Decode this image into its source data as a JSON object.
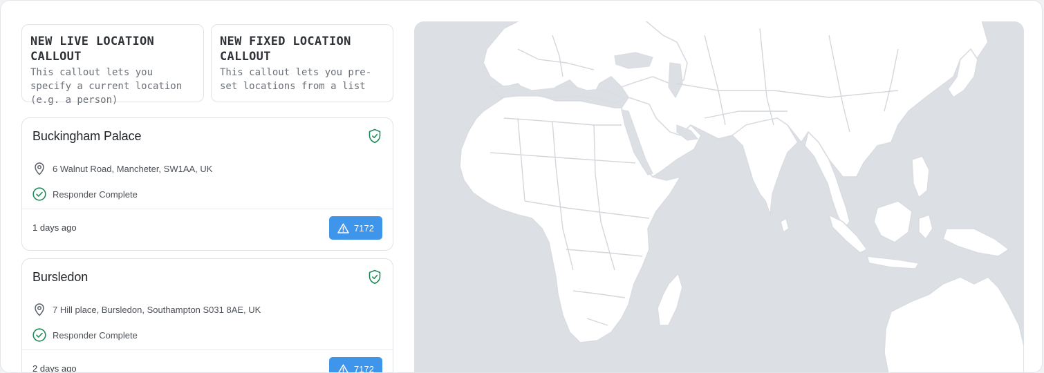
{
  "callout_options": [
    {
      "title": "NEW LIVE LOCATION CALLOUT",
      "description": "This callout lets you specify a current location (e.g. a person)"
    },
    {
      "title": "NEW FIXED LOCATION CALLOUT",
      "description": "This callout lets you pre-set locations from a list"
    }
  ],
  "locations": [
    {
      "name": "Buckingham Palace",
      "address": "6 Walnut Road, Mancheter, SW1AA, UK",
      "status": "Responder Complete",
      "time_ago": "1 days ago",
      "alert_count": "7172",
      "icons": {
        "verified": "shield-check-icon",
        "address": "map-pin-icon",
        "status": "check-circle-icon",
        "alert": "warning-triangle-icon"
      }
    },
    {
      "name": "Bursledon",
      "address": "7 Hill place, Bursledon, Southampton S031 8AE, UK",
      "status": "Responder Complete",
      "time_ago": "2 days ago",
      "alert_count": "7172",
      "icons": {
        "verified": "shield-check-icon",
        "address": "map-pin-icon",
        "status": "check-circle-icon",
        "alert": "warning-triangle-icon"
      }
    }
  ],
  "colors": {
    "accent_green": "#1f8a5a",
    "badge_blue": "#3f95ea",
    "map_water": "#dcdfe4",
    "map_land": "#ffffff"
  }
}
